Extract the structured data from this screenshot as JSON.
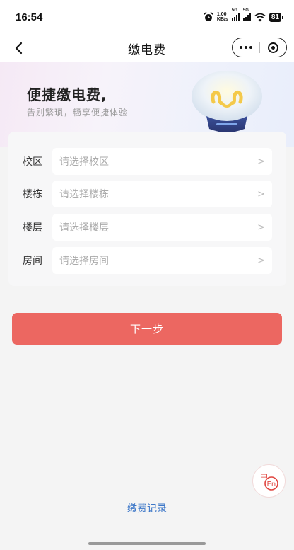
{
  "status_bar": {
    "time": "16:54",
    "speed_value": "1.00",
    "speed_unit": "KB/s",
    "sig1_label": "5G",
    "sig2_label": "5G",
    "battery": "81"
  },
  "nav": {
    "title": "缴电费"
  },
  "banner": {
    "title": "便捷缴电费,",
    "subtitle": "告别繁琐，畅享便捷体验"
  },
  "form": {
    "rows": [
      {
        "label": "校区",
        "placeholder": "请选择校区"
      },
      {
        "label": "楼栋",
        "placeholder": "请选择楼栋"
      },
      {
        "label": "楼层",
        "placeholder": "请选择楼层"
      },
      {
        "label": "房间",
        "placeholder": "请选择房间"
      }
    ],
    "chevron": ">"
  },
  "next_label": "下一步",
  "lang_button": {
    "top": "中",
    "bottom": "En"
  },
  "record_link": "缴费记录",
  "colors": {
    "primary": "#ec6761",
    "link": "#3d77c8",
    "placeholder": "#aaaaaa"
  },
  "icons": [
    "alarm-icon",
    "signal-icon",
    "wifi-icon",
    "battery-icon",
    "back-icon",
    "more-icon",
    "target-icon",
    "bulb-illustration",
    "chevron-right-icon",
    "language-icon"
  ]
}
